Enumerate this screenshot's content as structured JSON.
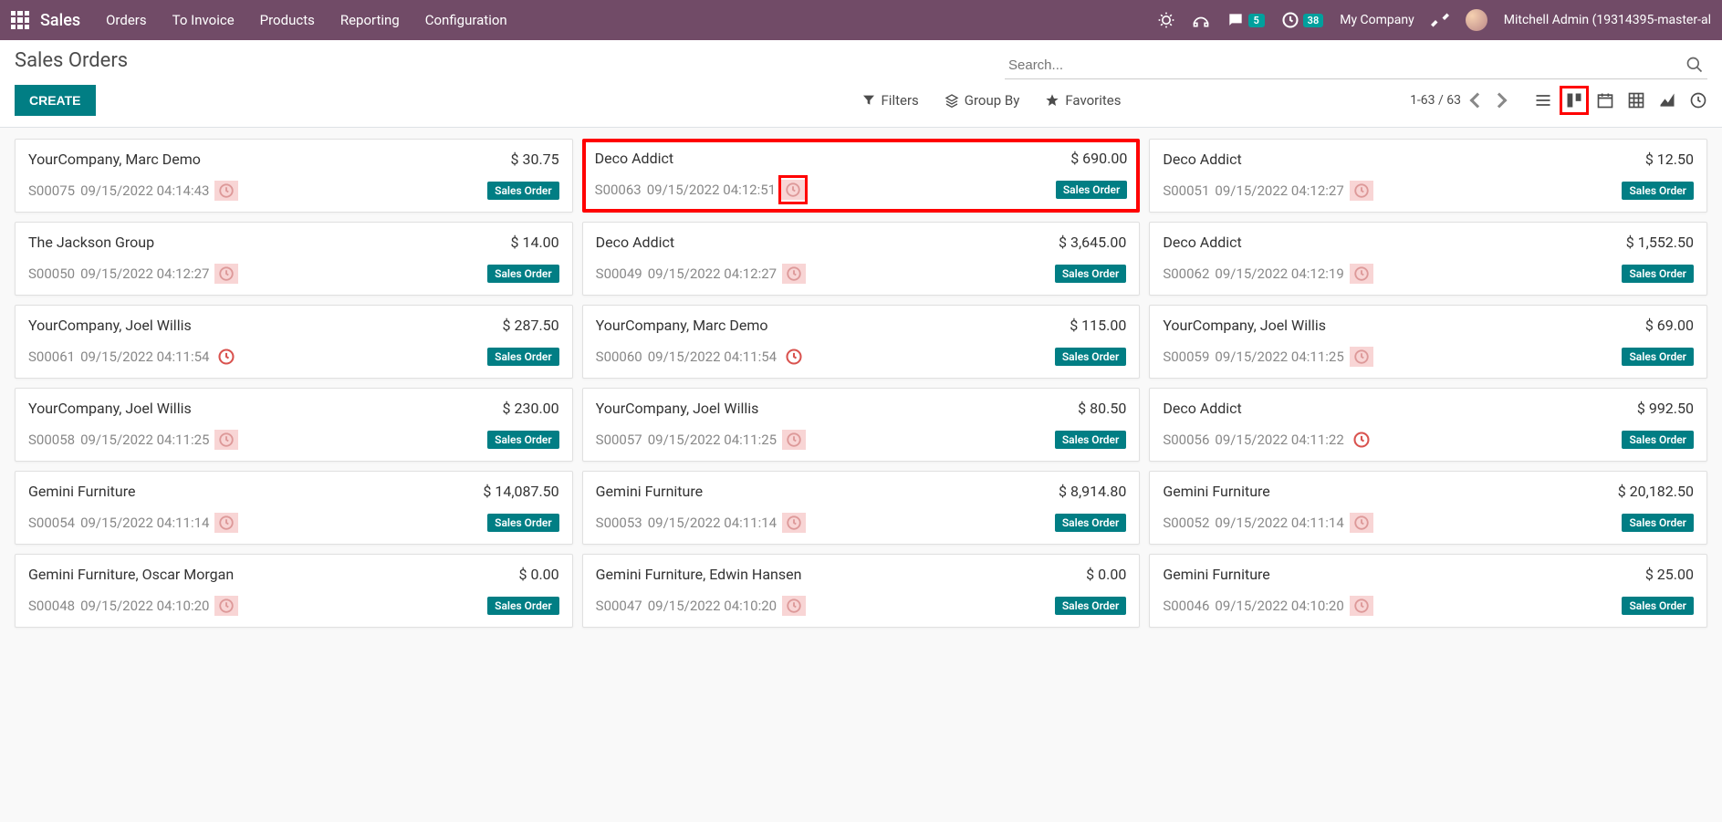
{
  "topnav": {
    "brand": "Sales",
    "links": [
      "Orders",
      "To Invoice",
      "Products",
      "Reporting",
      "Configuration"
    ],
    "msg_count": "5",
    "activity_count": "38",
    "company": "My Company",
    "user": "Mitchell Admin (19314395-master-al"
  },
  "page": {
    "title": "Sales Orders",
    "create_label": "CREATE",
    "search_placeholder": "Search...",
    "filters_label": "Filters",
    "groupby_label": "Group By",
    "favorites_label": "Favorites",
    "pager": "1-63 / 63"
  },
  "cards": [
    {
      "customer": "YourCompany, Marc Demo",
      "amount": "$ 30.75",
      "ref": "S00075",
      "date": "09/15/2022 04:14:43",
      "status": "Sales Order",
      "clock": "pink",
      "hl": false,
      "clock_hl": false
    },
    {
      "customer": "Deco Addict",
      "amount": "$ 690.00",
      "ref": "S00063",
      "date": "09/15/2022 04:12:51",
      "status": "Sales Order",
      "clock": "pink",
      "hl": true,
      "clock_hl": true
    },
    {
      "customer": "Deco Addict",
      "amount": "$ 12.50",
      "ref": "S00051",
      "date": "09/15/2022 04:12:27",
      "status": "Sales Order",
      "clock": "pink",
      "hl": false,
      "clock_hl": false
    },
    {
      "customer": "The Jackson Group",
      "amount": "$ 14.00",
      "ref": "S00050",
      "date": "09/15/2022 04:12:27",
      "status": "Sales Order",
      "clock": "pink",
      "hl": false,
      "clock_hl": false
    },
    {
      "customer": "Deco Addict",
      "amount": "$ 3,645.00",
      "ref": "S00049",
      "date": "09/15/2022 04:12:27",
      "status": "Sales Order",
      "clock": "pink",
      "hl": false,
      "clock_hl": false
    },
    {
      "customer": "Deco Addict",
      "amount": "$ 1,552.50",
      "ref": "S00062",
      "date": "09/15/2022 04:12:19",
      "status": "Sales Order",
      "clock": "pink",
      "hl": false,
      "clock_hl": false
    },
    {
      "customer": "YourCompany, Joel Willis",
      "amount": "$ 287.50",
      "ref": "S00061",
      "date": "09/15/2022 04:11:54",
      "status": "Sales Order",
      "clock": "red",
      "hl": false,
      "clock_hl": false
    },
    {
      "customer": "YourCompany, Marc Demo",
      "amount": "$ 115.00",
      "ref": "S00060",
      "date": "09/15/2022 04:11:54",
      "status": "Sales Order",
      "clock": "red",
      "hl": false,
      "clock_hl": false
    },
    {
      "customer": "YourCompany, Joel Willis",
      "amount": "$ 69.00",
      "ref": "S00059",
      "date": "09/15/2022 04:11:25",
      "status": "Sales Order",
      "clock": "pink",
      "hl": false,
      "clock_hl": false
    },
    {
      "customer": "YourCompany, Joel Willis",
      "amount": "$ 230.00",
      "ref": "S00058",
      "date": "09/15/2022 04:11:25",
      "status": "Sales Order",
      "clock": "pink",
      "hl": false,
      "clock_hl": false
    },
    {
      "customer": "YourCompany, Joel Willis",
      "amount": "$ 80.50",
      "ref": "S00057",
      "date": "09/15/2022 04:11:25",
      "status": "Sales Order",
      "clock": "pink",
      "hl": false,
      "clock_hl": false
    },
    {
      "customer": "Deco Addict",
      "amount": "$ 992.50",
      "ref": "S00056",
      "date": "09/15/2022 04:11:22",
      "status": "Sales Order",
      "clock": "red",
      "hl": false,
      "clock_hl": false
    },
    {
      "customer": "Gemini Furniture",
      "amount": "$ 14,087.50",
      "ref": "S00054",
      "date": "09/15/2022 04:11:14",
      "status": "Sales Order",
      "clock": "pink",
      "hl": false,
      "clock_hl": false
    },
    {
      "customer": "Gemini Furniture",
      "amount": "$ 8,914.80",
      "ref": "S00053",
      "date": "09/15/2022 04:11:14",
      "status": "Sales Order",
      "clock": "pink",
      "hl": false,
      "clock_hl": false
    },
    {
      "customer": "Gemini Furniture",
      "amount": "$ 20,182.50",
      "ref": "S00052",
      "date": "09/15/2022 04:11:14",
      "status": "Sales Order",
      "clock": "pink",
      "hl": false,
      "clock_hl": false
    },
    {
      "customer": "Gemini Furniture, Oscar Morgan",
      "amount": "$ 0.00",
      "ref": "S00048",
      "date": "09/15/2022 04:10:20",
      "status": "Sales Order",
      "clock": "pink",
      "hl": false,
      "clock_hl": false
    },
    {
      "customer": "Gemini Furniture, Edwin Hansen",
      "amount": "$ 0.00",
      "ref": "S00047",
      "date": "09/15/2022 04:10:20",
      "status": "Sales Order",
      "clock": "pink",
      "hl": false,
      "clock_hl": false
    },
    {
      "customer": "Gemini Furniture",
      "amount": "$ 25.00",
      "ref": "S00046",
      "date": "09/15/2022 04:10:20",
      "status": "Sales Order",
      "clock": "pink",
      "hl": false,
      "clock_hl": false
    }
  ]
}
